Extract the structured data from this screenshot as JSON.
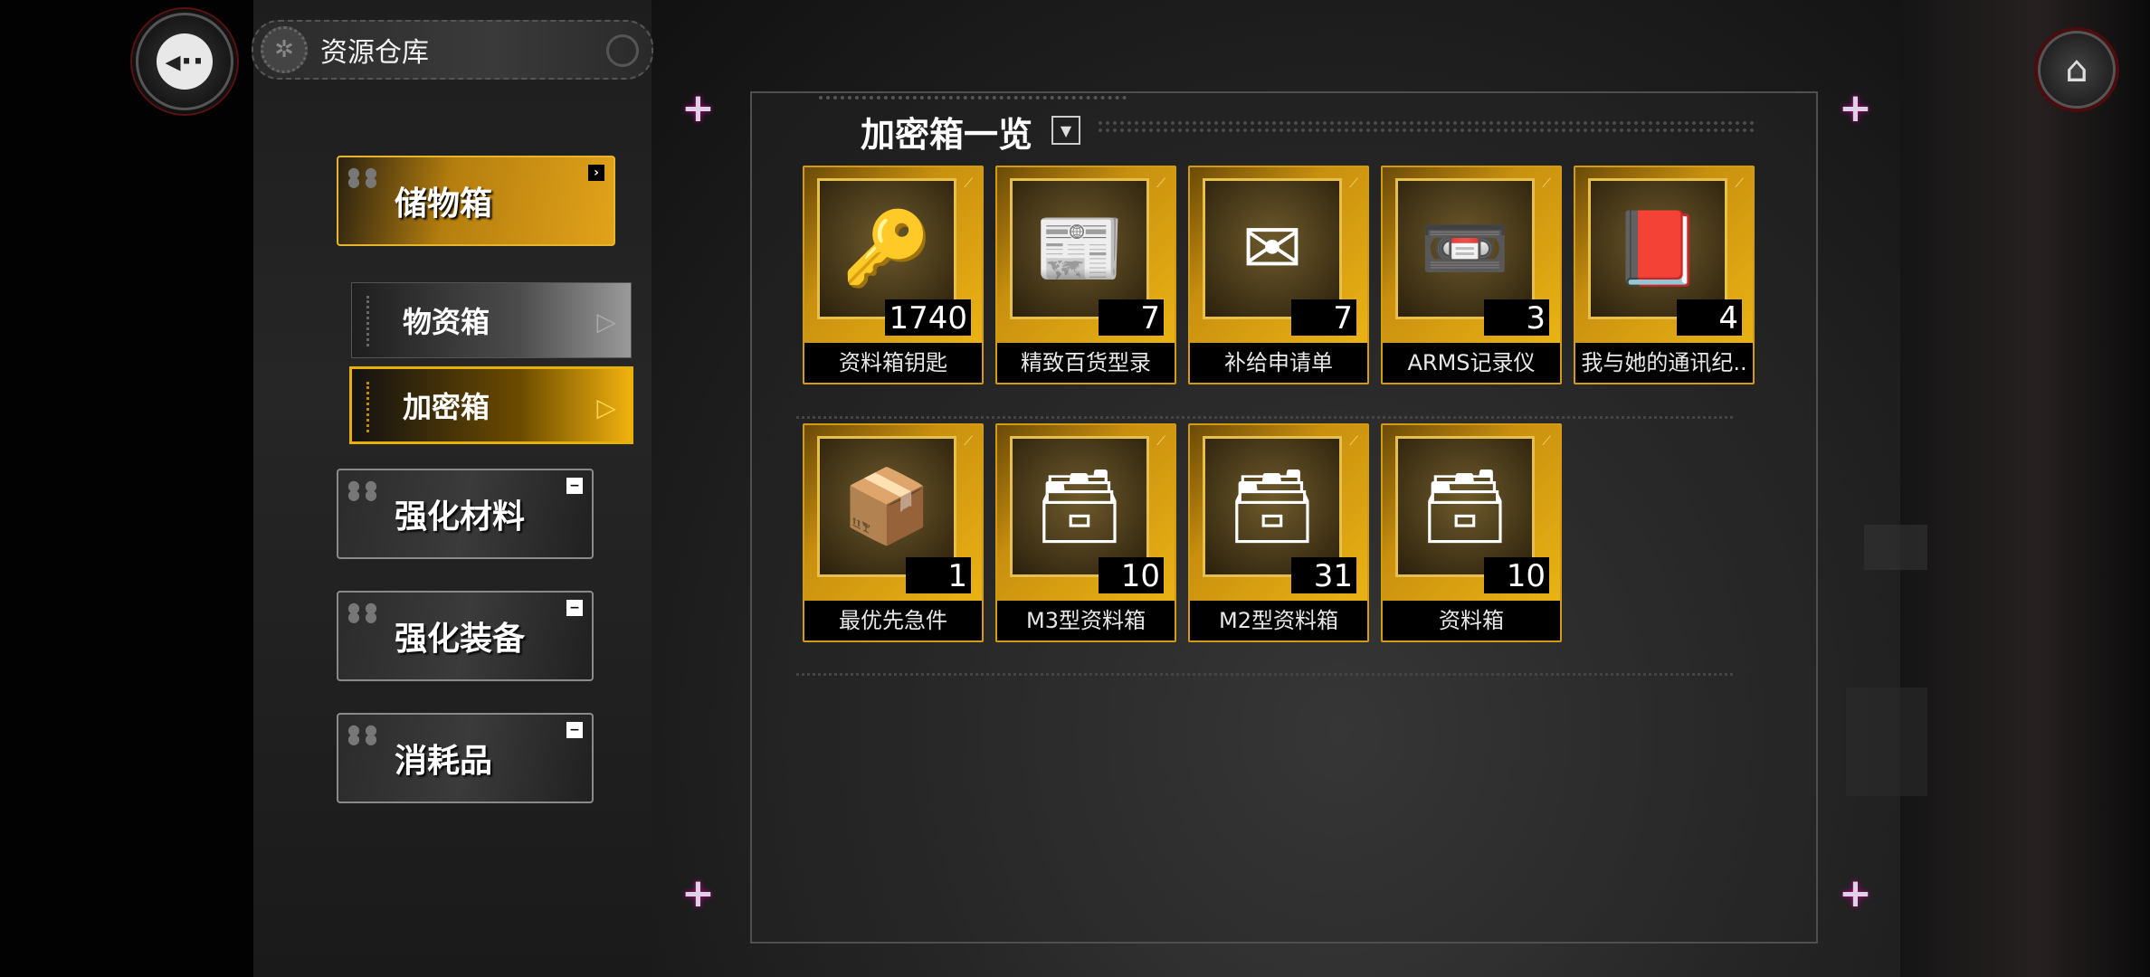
{
  "header": {
    "title": "资源仓库",
    "back_icon": "back-arrow-icon",
    "home_icon": "home-icon"
  },
  "sidebar": {
    "categories": [
      {
        "label": "储物箱",
        "active": true,
        "badge": "›"
      },
      {
        "label": "强化材料",
        "active": false,
        "badge": "−"
      },
      {
        "label": "强化装备",
        "active": false,
        "badge": "−"
      },
      {
        "label": "消耗品",
        "active": false,
        "badge": "−"
      }
    ],
    "subitems": [
      {
        "label": "物资箱",
        "active": false
      },
      {
        "label": "加密箱",
        "active": true
      }
    ]
  },
  "panel": {
    "title": "加密箱一览",
    "dropdown_icon": "▼",
    "items": [
      {
        "name": "资料箱钥匙",
        "count": "1740",
        "icon": "key-tag-icon"
      },
      {
        "name": "精致百货型录",
        "count": "7",
        "icon": "catalog-icon"
      },
      {
        "name": "补给申请单",
        "count": "7",
        "icon": "envelope-icon"
      },
      {
        "name": "ARMS记录仪",
        "count": "3",
        "icon": "recorder-icon"
      },
      {
        "name": "我与她的通讯纪..",
        "count": "4",
        "icon": "notebook-icon"
      },
      {
        "name": "最优先急件",
        "count": "1",
        "icon": "urgent-package-icon"
      },
      {
        "name": "M3型资料箱",
        "count": "10",
        "icon": "crate-icon"
      },
      {
        "name": "M2型资料箱",
        "count": "31",
        "icon": "crate-icon"
      },
      {
        "name": "资料箱",
        "count": "10",
        "icon": "crate-icon"
      }
    ]
  },
  "colors": {
    "accent": "#e8b000",
    "card_gold": "#f0b915"
  }
}
